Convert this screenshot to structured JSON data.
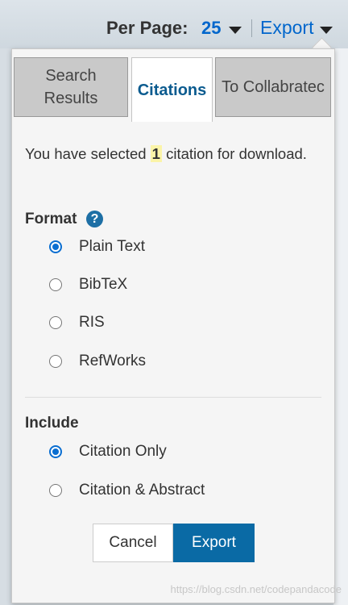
{
  "header": {
    "per_page_label": "Per Page:",
    "per_page_value": "25",
    "export_label": "Export"
  },
  "tabs": [
    {
      "label": "Search Results",
      "active": false
    },
    {
      "label": "Citations",
      "active": true
    },
    {
      "label": "To Collabratec",
      "active": false
    }
  ],
  "selection": {
    "prefix": "You have selected",
    "count": "1",
    "suffix": "citation for download."
  },
  "format": {
    "label": "Format",
    "help_icon": "question-icon",
    "options": [
      {
        "label": "Plain Text",
        "checked": true
      },
      {
        "label": "BibTeX",
        "checked": false
      },
      {
        "label": "RIS",
        "checked": false
      },
      {
        "label": "RefWorks",
        "checked": false
      }
    ]
  },
  "include": {
    "label": "Include",
    "options": [
      {
        "label": "Citation Only",
        "checked": true
      },
      {
        "label": "Citation & Abstract",
        "checked": false
      }
    ]
  },
  "buttons": {
    "cancel": "Cancel",
    "export": "Export"
  },
  "watermark": "https://blog.csdn.net/codepandacode",
  "colors": {
    "accent": "#0a6aa5",
    "link": "#0066cc",
    "highlight": "#fbf4a8"
  }
}
